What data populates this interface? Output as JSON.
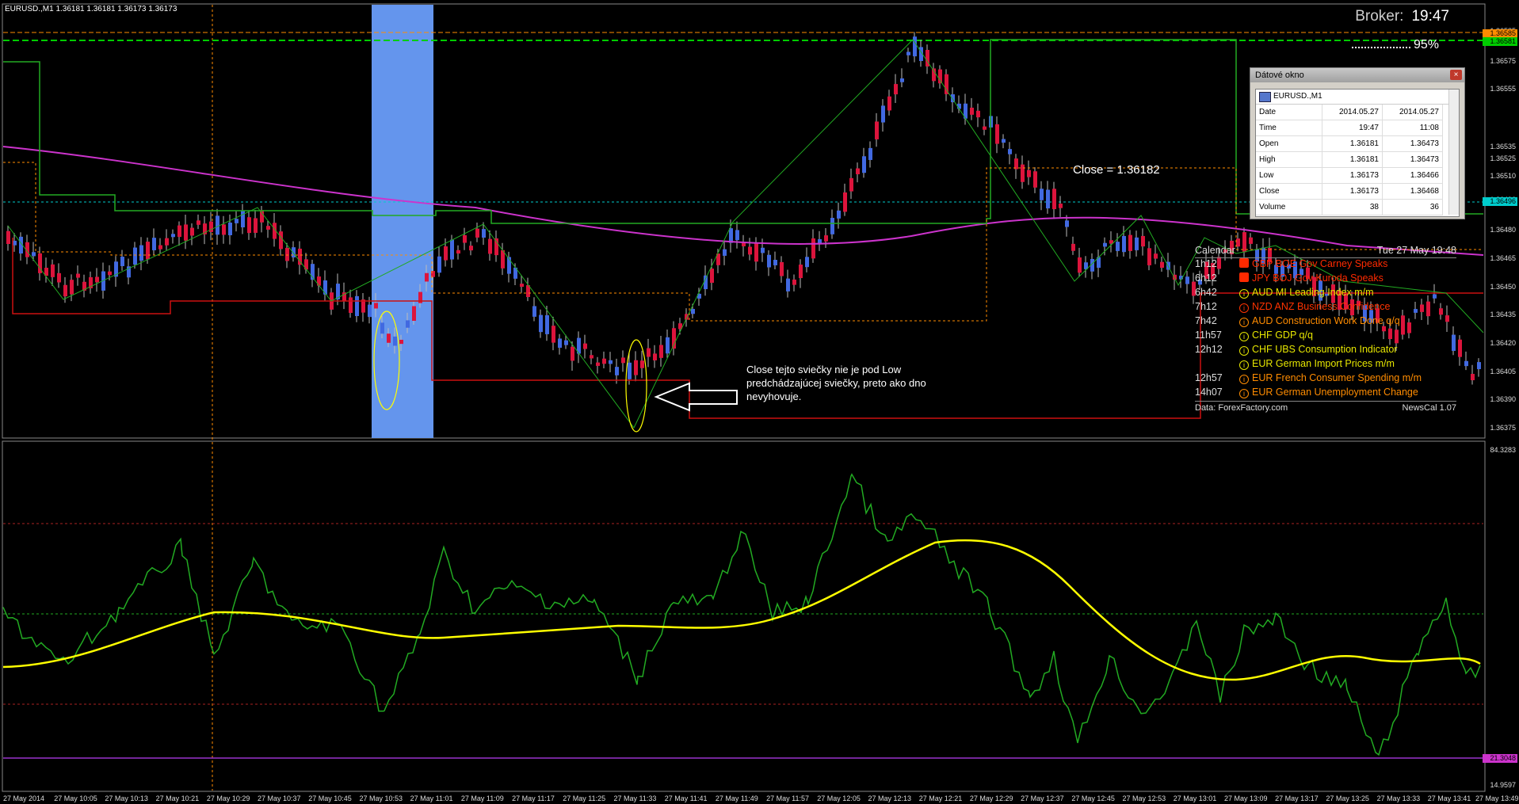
{
  "chart": {
    "title": "EURUSD.,M1  1.36181 1.36181 1.36173 1.36173",
    "broker_label": "Broker:",
    "broker_time": "19:47",
    "progress_text": "95%",
    "close_annotation": "Close = 1.36182",
    "note_lines": [
      "Close tejto sviečky nie je pod Low",
      "predchádzajúcej sviečky, preto ako dno",
      "nevyhovuje."
    ],
    "colors": {
      "background": "#000000",
      "bull": "#4169e1",
      "bear": "#dc143c",
      "ma": "#cc33cc",
      "zigzag": "#22aa22",
      "osc_signal": "#ffff00",
      "highlight": "#6495ed"
    }
  },
  "price_axis": {
    "labels": [
      "1.36585",
      "1.36581",
      "1.36575",
      "1.36555",
      "1.36535",
      "1.36525",
      "1.36510",
      "1.36496",
      "1.36480",
      "1.36465",
      "1.36450",
      "1.36435",
      "1.36420",
      "1.36405",
      "1.36390",
      "1.36375"
    ],
    "tags": [
      {
        "value": "1.36585",
        "color": "#ff8c00"
      },
      {
        "value": "1.36581",
        "color": "#00cc00"
      },
      {
        "value": "1.36496",
        "color": "#00cccc"
      }
    ]
  },
  "osc_axis": {
    "labels": [
      "84.3283",
      "21.3048",
      "14.9597"
    ],
    "tag_color": "#cc33cc"
  },
  "time_axis": [
    "27 May 2014",
    "27 May 10:05",
    "27 May 10:13",
    "27 May 10:21",
    "27 May 10:29",
    "27 May 10:37",
    "27 May 10:45",
    "27 May 10:53",
    "27 May 11:01",
    "27 May 11:09",
    "27 May 11:17",
    "27 May 11:25",
    "27 May 11:33",
    "27 May 11:41",
    "27 May 11:49",
    "27 May 11:57",
    "27 May 12:05",
    "27 May 12:13",
    "27 May 12:21",
    "27 May 12:29",
    "27 May 12:37",
    "27 May 12:45",
    "27 May 12:53",
    "27 May 13:01",
    "27 May 13:09",
    "27 May 13:17",
    "27 May 13:25",
    "27 May 13:33",
    "27 May 13:41",
    "27 May 13:49"
  ],
  "data_window": {
    "title": "Dátové okno",
    "close_symbol": "×",
    "symbol": "EURUSD.,M1",
    "rows": [
      {
        "k": "Date",
        "a": "2014.05.27",
        "b": "2014.05.27"
      },
      {
        "k": "Time",
        "a": "19:47",
        "b": "11:08"
      },
      {
        "k": "Open",
        "a": "1.36181",
        "b": "1.36473"
      },
      {
        "k": "High",
        "a": "1.36181",
        "b": "1.36473"
      },
      {
        "k": "Low",
        "a": "1.36173",
        "b": "1.36466"
      },
      {
        "k": "Close",
        "a": "1.36173",
        "b": "1.36468"
      },
      {
        "k": "Volume",
        "a": "38",
        "b": "36"
      }
    ]
  },
  "calendar": {
    "header_left": "Calendar",
    "header_right": "Tue 27 May 19:48",
    "events": [
      {
        "time": "1h12",
        "cur": "GBP",
        "name": "BOE Gov Carney Speaks",
        "color": "#ff2a00",
        "icon": "flag"
      },
      {
        "time": "6h12",
        "cur": "JPY",
        "name": "BOJ Gov Kuroda Speaks",
        "color": "#ff2a00",
        "icon": "flag"
      },
      {
        "time": "6h42",
        "cur": "AUD",
        "name": "MI Leading Index m/m",
        "color": "#e6e600",
        "icon": "i"
      },
      {
        "time": "7h12",
        "cur": "NZD",
        "name": "ANZ Business Confidence",
        "color": "#ff3300",
        "icon": "i"
      },
      {
        "time": "7h42",
        "cur": "AUD",
        "name": "Construction Work Done q/q",
        "color": "#ff8c00",
        "icon": "i"
      },
      {
        "time": "11h57",
        "cur": "CHF",
        "name": "GDP q/q",
        "color": "#e6e600",
        "icon": "i"
      },
      {
        "time": "12h12",
        "cur": "CHF",
        "name": "UBS Consumption Indicator",
        "color": "#e6e600",
        "icon": "i"
      },
      {
        "time": "",
        "cur": "EUR",
        "name": "German Import Prices m/m",
        "color": "#e6e600",
        "icon": "i"
      },
      {
        "time": "12h57",
        "cur": "EUR",
        "name": "French Consumer Spending m/m",
        "color": "#ff8c00",
        "icon": "i"
      },
      {
        "time": "14h07",
        "cur": "EUR",
        "name": "German Unemployment Change",
        "color": "#ff8c00",
        "icon": "i"
      }
    ],
    "footer_left": "Data: ForexFactory.com",
    "footer_right": "NewsCal 1.07"
  }
}
